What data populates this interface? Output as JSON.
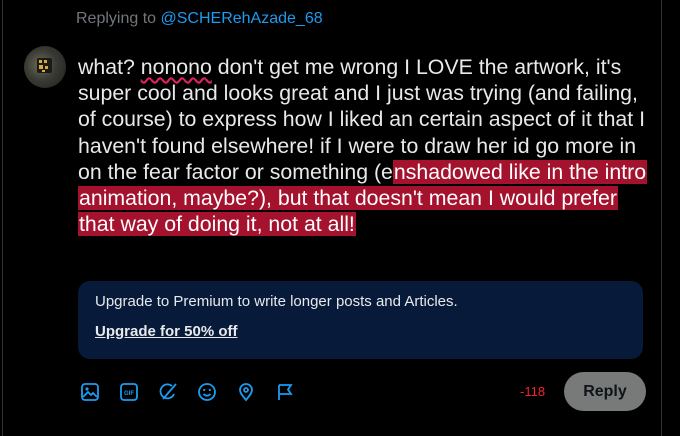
{
  "reply_context": {
    "prefix": "Replying to",
    "handle": "@SCHERehAzade_68"
  },
  "post": {
    "seg1": "what? ",
    "misspelled": "nonono",
    "seg2": " don't get me wrong I LOVE the artwork, it's super cool and looks great and I just was trying (and failing, of course) to express how I liked an certain aspect of it that I haven't found elsewhere! if I were to draw her id go more in on the fear factor or something (e",
    "overflow": "nshadowed like in the intro animation, maybe?), but that doesn't mean I would prefer that way of doing it, not at all!"
  },
  "upsell": {
    "message": "Upgrade to Premium to write longer posts and Articles.",
    "cta": "Upgrade for 50% off"
  },
  "toolbar": {
    "icons": [
      "image-icon",
      "gif-icon",
      "grok-icon",
      "emoji-icon",
      "location-icon",
      "flag-icon"
    ],
    "accent": "#1d9bf0"
  },
  "composer": {
    "char_counter": "-118",
    "reply_label": "Reply"
  },
  "colors": {
    "background": "#000000",
    "text": "#e7e9ea",
    "muted": "#71767b",
    "link": "#1d9bf0",
    "overflow_highlight": "#a4122e",
    "upsell_bg": "#071a3a",
    "counter_red": "#f4212e",
    "reply_button_bg": "#787a7a"
  }
}
